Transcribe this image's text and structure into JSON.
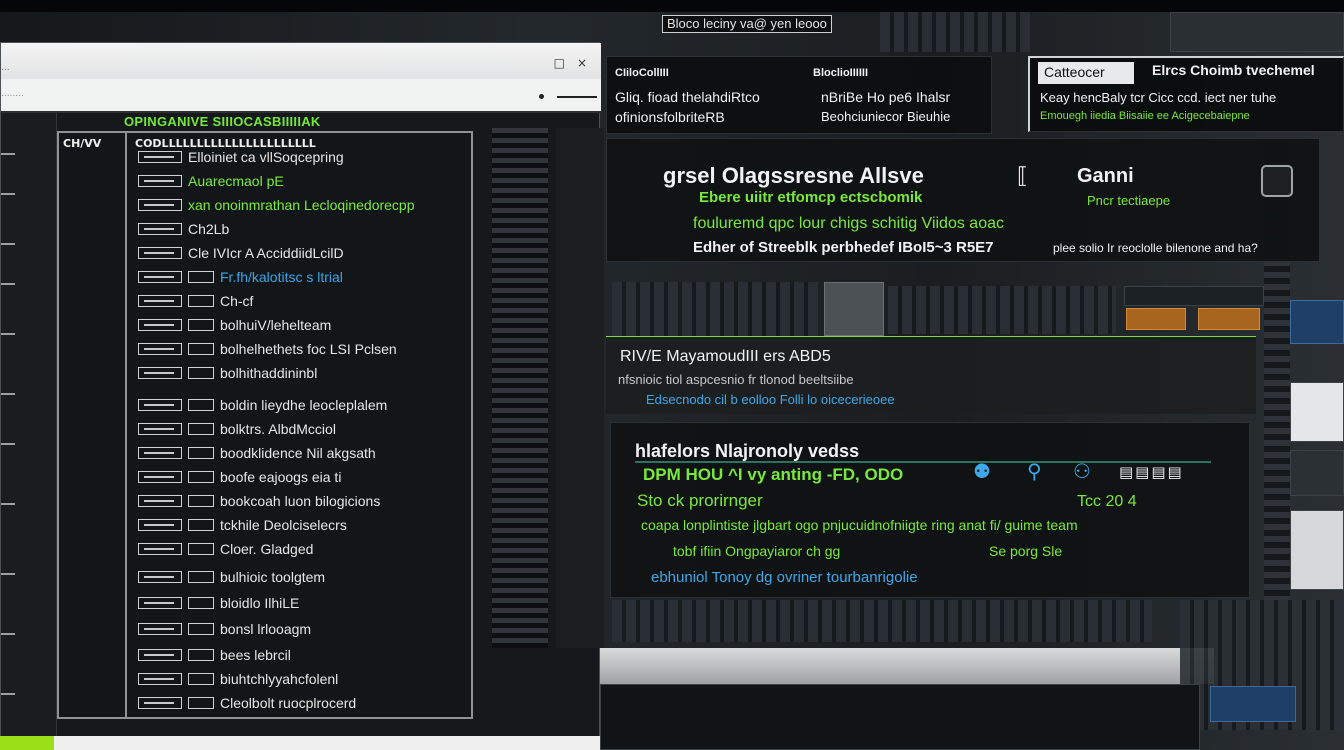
{
  "top_label": "Bloco leciny va@ yen leooo",
  "left_window": {
    "titlebar_text": "...",
    "window_controls": [
      "□",
      "×"
    ],
    "address_text": "........",
    "tree_header_left": "CH/VV",
    "tree_header_right": "CODLLLLLLLLLLLLLLLLLLLLLL",
    "tree_top_banner": "OPINGANIVE SIIIOCASBIIIIIAK",
    "rows": [
      {
        "label": "",
        "text": "Elloiniet ca vllSoqcepring",
        "color": "white"
      },
      {
        "label": "",
        "text": "Auarecmaol pE",
        "color": "green"
      },
      {
        "label": "",
        "text": "xan onoinmrathan  Lecloqinedorecpp",
        "color": "green"
      },
      {
        "label": "",
        "text": "Ch2Lb",
        "color": "white"
      },
      {
        "label": "",
        "text": "Cle IVIcr A AcciddiidLcilD",
        "color": "white"
      },
      {
        "label": "",
        "text": "Fr.fh/kalotitsc  s ltrial",
        "color": "blue"
      },
      {
        "label": "",
        "text": "Ch-cf",
        "color": "white"
      },
      {
        "label": "",
        "text": "bolhuiV/lehelteam",
        "color": "white"
      },
      {
        "label": "",
        "text": "bolhelhethets foc LSI Pclsen",
        "color": "white"
      },
      {
        "label": "",
        "text": "bolhithaddininbl",
        "color": "white"
      },
      {
        "label": "",
        "text": "boldin lieydhe leocleplalem",
        "color": "white"
      },
      {
        "label": "",
        "text": "bolktrs. AlbdMcciol",
        "color": "white"
      },
      {
        "label": "",
        "text": "boodklidence Nil akgsath",
        "color": "white"
      },
      {
        "label": "",
        "text": "boofe eajoogs eia ti",
        "color": "white"
      },
      {
        "label": "",
        "text": "bookcoah luon bilogicions",
        "color": "white"
      },
      {
        "label": "",
        "text": "tckhile Deolciselecrs",
        "color": "white"
      },
      {
        "label": "",
        "text": "Cloer. Gladged",
        "color": "white"
      },
      {
        "label": "",
        "text": "bulhioic toolgtem",
        "color": "white"
      },
      {
        "label": "",
        "text": "bloidlo IlhiLE",
        "color": "white"
      },
      {
        "label": "",
        "text": "bonsl lrlooagm",
        "color": "white"
      },
      {
        "label": "",
        "text": "bees lebrcil",
        "color": "white"
      },
      {
        "label": "",
        "text": "biuhtchlyyahcfolenl",
        "color": "white"
      },
      {
        "label": "",
        "text": "Cleolbolt ruocplrocerd",
        "color": "white"
      }
    ]
  },
  "panel_status": {
    "col_a_title": "CIiloCollIII",
    "col_b_title": "BloclioIIIIII",
    "line1_a": "Gliq. fioad thelahdiRtco",
    "line1_b": "nBriBe Ho pe6  Ihalsr",
    "line2_a": "ofinionsfolbriteRB",
    "line2_b": "Beohciuniecor  Bieuhie"
  },
  "panel_catalog": {
    "tab": "Catteocer",
    "title": "Elrcs Choimb tvechemel",
    "line1": "Keay hencBaly  tcr Cicc  ccd.  iect ner tuhe",
    "line2": "Emouegh iiedia Biisaiie ee Acigecebaiepne"
  },
  "panel_main": {
    "title": "grsel Olagssresne Allsve",
    "right_title": "Ganni",
    "right_sub": "Pncr tectiaepe",
    "line1": "Ebere uiitr etfomcp ectscbomik",
    "line2": "fouluremd  qpc lour  chigs  schitig Viidos aoac",
    "line3": "Edher of Streeblk  perbhedef IBoI5~3 R5E7",
    "line3_right": "plee solio Ir reoclolle bilenone and ha?"
  },
  "panel_network": {
    "title": "RIV/E MayamoudIII  ers ABD5",
    "line1": "nfsnioic tiol aspcesnio fr tlonod  beeltsiibe",
    "line2": "Edsecnodo cil b eolloo Folli lo oicecerieoee"
  },
  "panel_report": {
    "title": "hlafelors Nlajronoly vedss",
    "row1_left": "DPM HOU ^I vy anting -FD, ODO",
    "row1_right_icons": [
      "dash",
      "person",
      "group",
      "bars"
    ],
    "row2": "Sto ck prorirnger",
    "row2_right": "Tcc 20 4",
    "row3": "coapa lonplintiste jlgbart ogo pnjucuidnofniigte ring anat fi/ guime team",
    "row4_left": "tobf ifiin Ongpayiaror ch gg",
    "row4_right": "Se porg Sle",
    "row5": "ebhuniol Tonoy dg  ovriner tourbanrigolie"
  },
  "colors": {
    "accent_green": "#79e83c",
    "accent_blue": "#3ea8e8",
    "panel_bg": "#0c0e0f",
    "lime_bar": "#9adf18"
  }
}
